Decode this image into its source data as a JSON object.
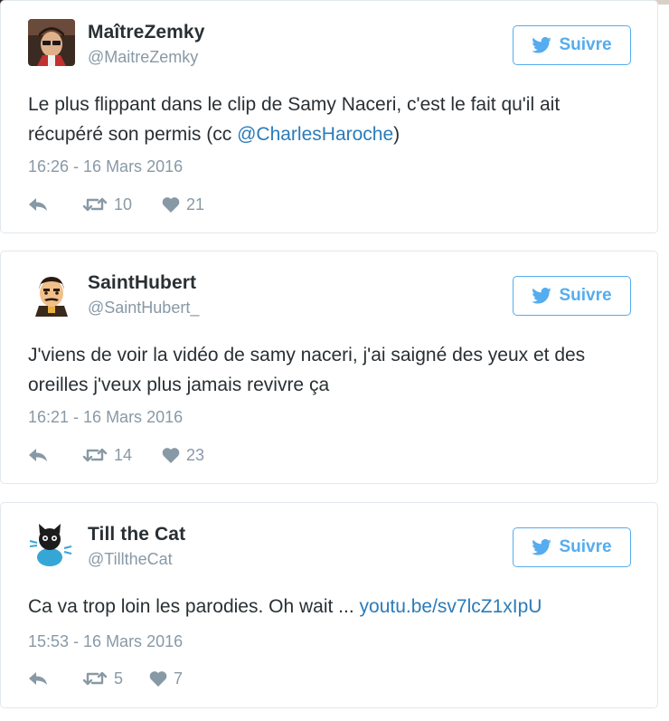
{
  "tweets": [
    {
      "name": "MaîtreZemky",
      "handle": "@MaitreZemky",
      "follow_label": "Suivre",
      "text_before": "Le plus flippant dans le clip de Samy Naceri, c'est le fait qu'il ait récupéré son permis (cc ",
      "mention": "@CharlesHaroche",
      "text_after": ")",
      "timestamp": "16:26 - 16 Mars 2016",
      "retweets": "10",
      "likes": "21"
    },
    {
      "name": "SaintHubert",
      "handle": "@SaintHubert_",
      "follow_label": "Suivre",
      "text": "J'viens de voir la vidéo de samy naceri, j'ai saigné des yeux et des oreilles j'veux plus jamais revivre ça",
      "timestamp": "16:21 - 16 Mars 2016",
      "retweets": "14",
      "likes": "23"
    },
    {
      "name": "Till the Cat",
      "handle": "@TilltheCat",
      "follow_label": "Suivre",
      "text_before": "Ca va trop loin les parodies. Oh wait ... ",
      "link": "youtu.be/sv7lcZ1xIpU",
      "timestamp": "15:53 - 16 Mars 2016",
      "retweets": "5",
      "likes": "7"
    }
  ],
  "colors": {
    "accent": "#55acee",
    "link": "#2b7bb9",
    "muted": "#8899a6",
    "text": "#292f33",
    "border": "#e1e8ed"
  },
  "icons": {
    "follow": "bird-icon",
    "reply": "reply-icon",
    "retweet": "retweet-icon",
    "like": "heart-icon"
  }
}
